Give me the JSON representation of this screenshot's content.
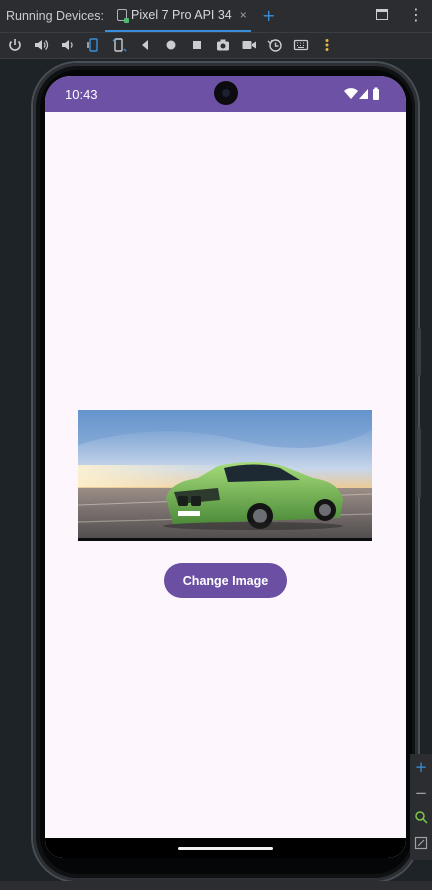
{
  "ide": {
    "running_devices_label": "Running Devices:",
    "device_tab_label": "Pixel 7 Pro API 34",
    "tab_close": "×",
    "add_tab": "+",
    "more": "⋮"
  },
  "toolbar": {
    "icons": [
      "power-icon",
      "volume-up-icon",
      "volume-down-icon",
      "rotate-left-icon",
      "rotate-right-icon",
      "back-icon",
      "home-icon",
      "overview-icon",
      "screenshot-icon",
      "screen-record-icon",
      "snapshot-icon",
      "keyboard-icon",
      "more-icon"
    ]
  },
  "phone": {
    "status_time": "10:43",
    "status_icons": [
      "wifi-icon",
      "signal-icon",
      "battery-icon"
    ],
    "accent_color": "#6d51a4",
    "image_alt": "green-sports-car",
    "button_label": "Change Image"
  },
  "zoom": {
    "plus": "+",
    "minus": "−"
  }
}
